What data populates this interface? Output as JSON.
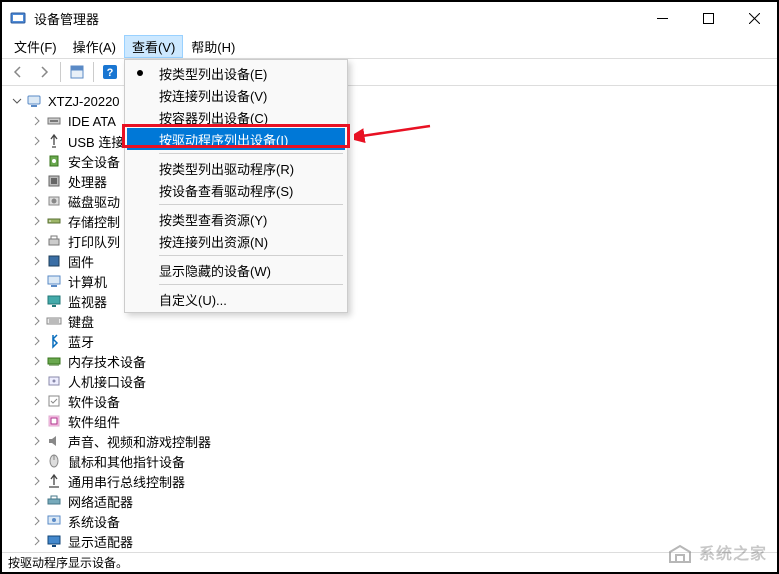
{
  "window": {
    "title": "设备管理器"
  },
  "menubar": {
    "file": "文件(F)",
    "action": "操作(A)",
    "view": "查看(V)",
    "help": "帮助(H)"
  },
  "view_menu": {
    "items": [
      {
        "label": "按类型列出设备(E)",
        "bullet": true
      },
      {
        "label": "按连接列出设备(V)"
      },
      {
        "label": "按容器列出设备(C)"
      },
      {
        "label": "按驱动程序列出设备(I)",
        "highlight": true
      },
      {
        "sep": true
      },
      {
        "label": "按类型列出驱动程序(R)"
      },
      {
        "label": "按设备查看驱动程序(S)"
      },
      {
        "sep": true
      },
      {
        "label": "按类型查看资源(Y)"
      },
      {
        "label": "按连接列出资源(N)"
      },
      {
        "sep": true
      },
      {
        "label": "显示隐藏的设备(W)"
      },
      {
        "sep": true
      },
      {
        "label": "自定义(U)..."
      }
    ]
  },
  "tree": {
    "root": "XTZJ-20220",
    "nodes": [
      {
        "label": "IDE ATA",
        "icon": "ide"
      },
      {
        "label": "USB 连接",
        "icon": "usb"
      },
      {
        "label": "安全设备",
        "icon": "security"
      },
      {
        "label": "处理器",
        "icon": "cpu"
      },
      {
        "label": "磁盘驱动",
        "icon": "disk"
      },
      {
        "label": "存储控制",
        "icon": "storage"
      },
      {
        "label": "打印队列",
        "icon": "printer"
      },
      {
        "label": "固件",
        "icon": "firmware"
      },
      {
        "label": "计算机",
        "icon": "computer"
      },
      {
        "label": "监视器",
        "icon": "monitor"
      },
      {
        "label": "键盘",
        "icon": "keyboard"
      },
      {
        "label": "蓝牙",
        "icon": "bluetooth"
      },
      {
        "label": "内存技术设备",
        "icon": "memory"
      },
      {
        "label": "人机接口设备",
        "icon": "hid"
      },
      {
        "label": "软件设备",
        "icon": "software"
      },
      {
        "label": "软件组件",
        "icon": "component"
      },
      {
        "label": "声音、视频和游戏控制器",
        "icon": "sound"
      },
      {
        "label": "鼠标和其他指针设备",
        "icon": "mouse"
      },
      {
        "label": "通用串行总线控制器",
        "icon": "usbctl"
      },
      {
        "label": "网络适配器",
        "icon": "network"
      },
      {
        "label": "系统设备",
        "icon": "system"
      },
      {
        "label": "显示适配器",
        "icon": "display"
      }
    ]
  },
  "statusbar": {
    "text": "按驱动程序显示设备。"
  },
  "watermark": "系统之家"
}
